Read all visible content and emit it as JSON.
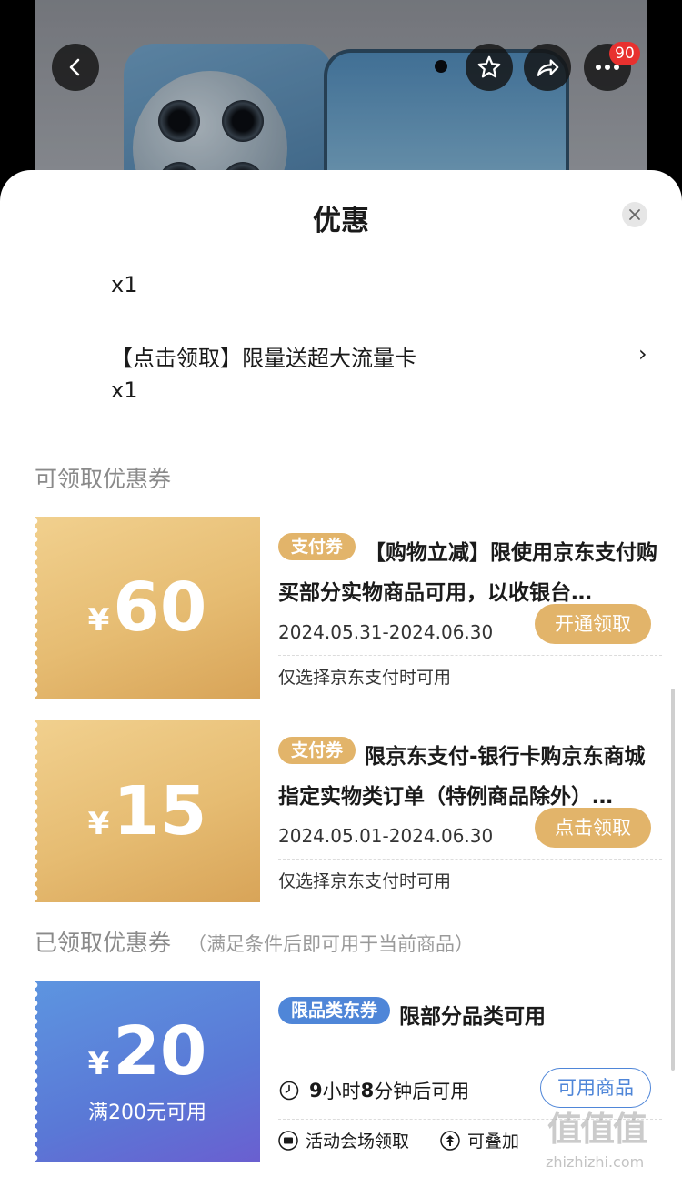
{
  "header": {
    "notification_count": "90"
  },
  "sheet": {
    "title": "优惠",
    "gifts": [
      {
        "qty": "x1"
      },
      {
        "label": "【点击领取】限量送超大流量卡",
        "qty": "x1"
      }
    ]
  },
  "available_section": {
    "title": "可领取优惠券",
    "coupons": [
      {
        "currency": "¥",
        "amount": "60",
        "tag": "支付券",
        "desc": "【购物立减】限使用京东支付购买部分实物商品可用，以收银台…",
        "date": "2024.05.31-2024.06.30",
        "button": "开通领取",
        "note": "仅选择京东支付时可用"
      },
      {
        "currency": "¥",
        "amount": "15",
        "tag": "支付券",
        "desc": "限京东支付-银行卡购京东商城指定实物类订单（特例商品除外）…",
        "date": "2024.05.01-2024.06.30",
        "button": "点击领取",
        "note": "仅选择京东支付时可用"
      }
    ]
  },
  "received_section": {
    "title": "已领取优惠券",
    "note": "（满足条件后即可用于当前商品）",
    "coupon": {
      "currency": "¥",
      "amount": "20",
      "condition": "满200元可用",
      "tag": "限品类东券",
      "desc": "限部分品类可用",
      "timer_hours": "9",
      "timer_text1": "小时",
      "timer_minutes": "8",
      "timer_text2": "分钟后可用",
      "button": "可用商品",
      "source": "活动会场领取",
      "stackable": "可叠加"
    }
  },
  "watermark": {
    "text": "zhizhizhi.com",
    "big": "值值值"
  },
  "colors": {
    "gold": "#e2b46a",
    "blue": "#4f86d8"
  }
}
